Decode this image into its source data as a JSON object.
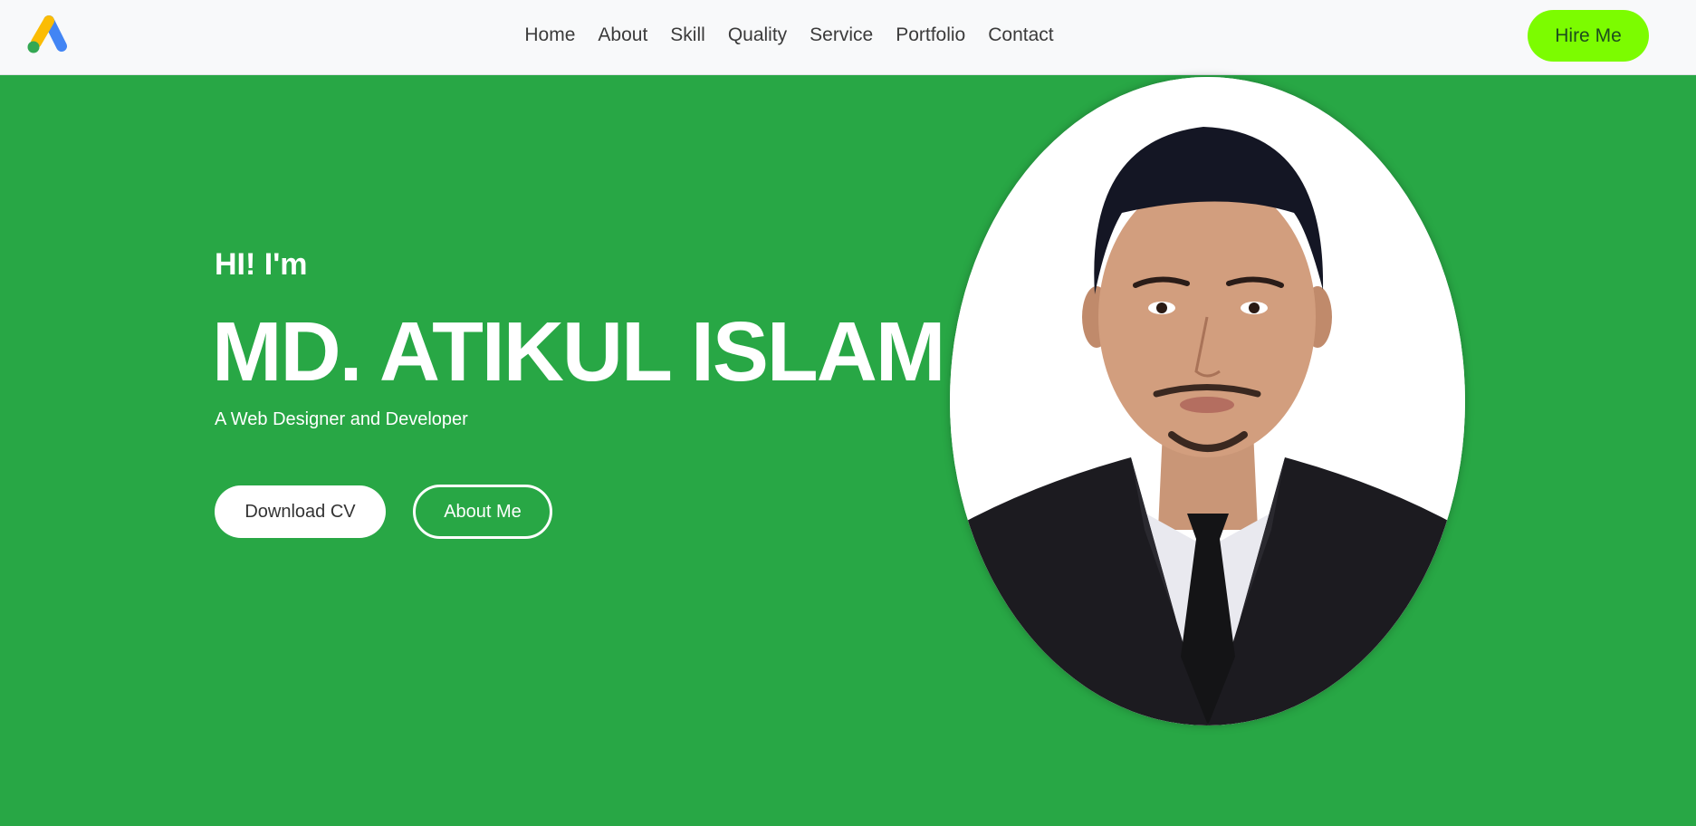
{
  "header": {
    "logo_icon": "google-ads-logo-icon",
    "nav": [
      {
        "label": "Home"
      },
      {
        "label": "About"
      },
      {
        "label": "Skill"
      },
      {
        "label": "Quality"
      },
      {
        "label": "Service"
      },
      {
        "label": "Portfolio"
      },
      {
        "label": "Contact"
      }
    ],
    "hire_label": "Hire Me"
  },
  "hero": {
    "greeting": "HI! I'm",
    "name": "MD. ATIKUL ISLAM",
    "subtitle": "A Web Designer and Developer",
    "download_label": "Download CV",
    "about_label": "About Me"
  },
  "colors": {
    "background": "#28a745",
    "hire_button": "#7cfc00",
    "navbar": "#f8f9fa"
  }
}
